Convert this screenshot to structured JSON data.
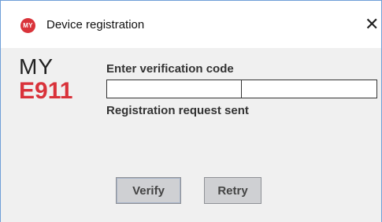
{
  "window": {
    "title": "Device registration",
    "app_icon_text": "MY",
    "close_glyph": "✕"
  },
  "logo": {
    "line1": "MY",
    "line2": "E911",
    "accent": "#d9323a"
  },
  "form": {
    "label": "Enter verification code",
    "code_part1": "",
    "code_part2": "",
    "status": "Registration request sent"
  },
  "buttons": {
    "verify": "Verify",
    "retry": "Retry"
  }
}
